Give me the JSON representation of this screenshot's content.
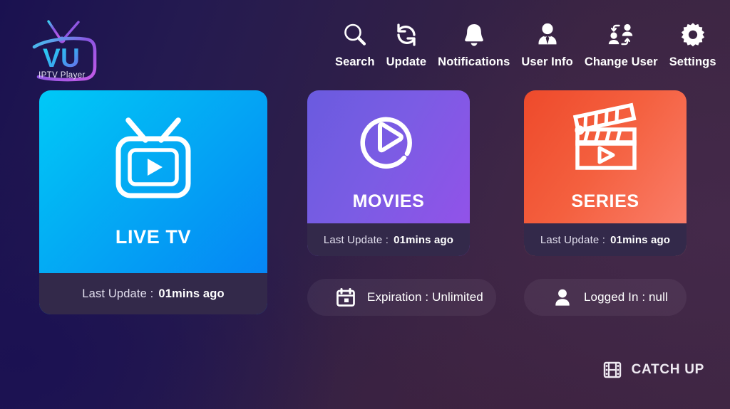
{
  "app": {
    "logo": {
      "brand": "VU",
      "tagline": "IPTV Player",
      "icon": "tv-logo-icon"
    }
  },
  "topnav": {
    "items": [
      {
        "label": "Search",
        "icon": "search-icon"
      },
      {
        "label": "Update",
        "icon": "refresh-icon"
      },
      {
        "label": "Notifications",
        "icon": "bell-icon"
      },
      {
        "label": "User Info",
        "icon": "user-tie-icon"
      },
      {
        "label": "Change User",
        "icon": "swap-users-icon"
      },
      {
        "label": "Settings",
        "icon": "gear-icon"
      }
    ]
  },
  "cards": [
    {
      "id": "live",
      "title": "LIVE TV",
      "icon": "tv-play-icon",
      "footer_label": "Last Update :",
      "footer_value": "01mins ago",
      "gradient_from": "#00c9f7",
      "gradient_to": "#067ff5"
    },
    {
      "id": "movies",
      "title": "MOVIES",
      "icon": "circle-play-icon",
      "footer_label": "Last Update :",
      "footer_value": "01mins ago",
      "gradient_from": "#6a5bdf",
      "gradient_to": "#9551e9"
    },
    {
      "id": "series",
      "title": "SERIES",
      "icon": "clapperboard-play-icon",
      "footer_label": "Last Update :",
      "footer_value": "01mins ago",
      "gradient_from": "#ee4a2b",
      "gradient_to": "#fb8270"
    }
  ],
  "pills": [
    {
      "id": "expiration",
      "icon": "calendar-icon",
      "text": "Expiration : Unlimited"
    },
    {
      "id": "login",
      "icon": "user-icon",
      "text": "Logged In : null"
    }
  ],
  "catchup": {
    "label": "CATCH UP",
    "icon": "film-strip-icon"
  },
  "theme": {
    "background_left": "#1a1150",
    "background_right": "#3e2742",
    "card_footer_bg": "#33294a",
    "text": "#ffffff"
  }
}
